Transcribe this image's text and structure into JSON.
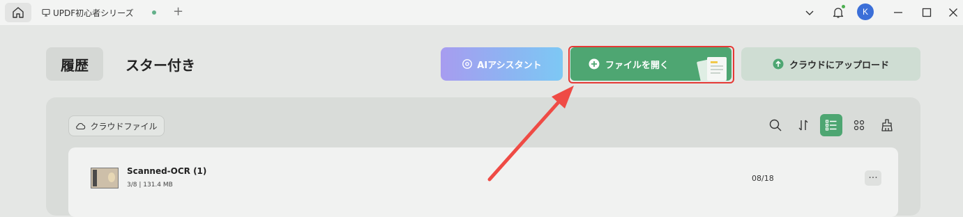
{
  "titlebar": {
    "tab_label": "UPDF初心者シリーズ",
    "new_tab_symbol": "+",
    "avatar_letter": "K"
  },
  "header": {
    "tab_history": "履歴",
    "tab_starred": "スター付き",
    "ai_button": "AIアシスタント",
    "open_button": "ファイルを開く",
    "cloud_upload_button": "クラウドにアップロード"
  },
  "panel": {
    "cloud_chip": "クラウドファイル",
    "tools": [
      "search-icon",
      "sort-icon",
      "list-view-icon",
      "grid-view-icon",
      "clear-icon"
    ],
    "files": [
      {
        "name": "Scanned-OCR (1)",
        "meta": "3/8 | 131.4 MB",
        "date": "08/18",
        "more": "···"
      }
    ]
  },
  "colors": {
    "accent_green": "#4ea672",
    "highlight_red": "#e53935",
    "avatar_blue": "#3b6fd8"
  }
}
